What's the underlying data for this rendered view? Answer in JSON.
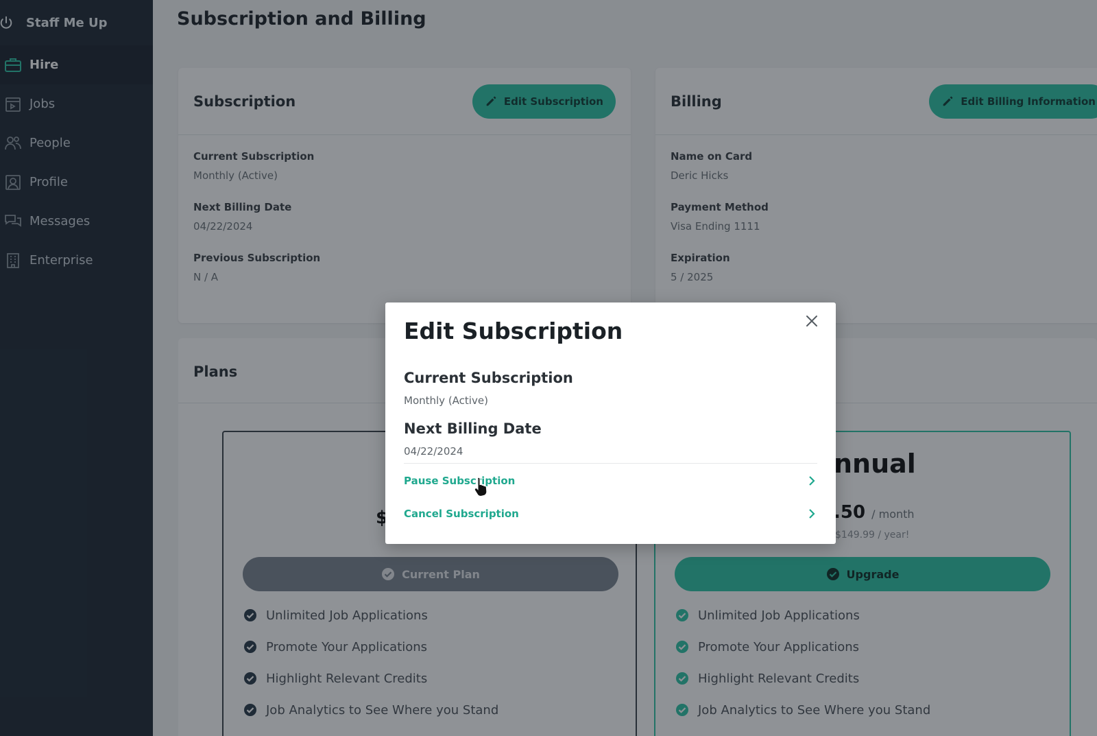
{
  "brand": {
    "name": "Staff Me Up"
  },
  "sidebar": {
    "items": [
      {
        "label": "Hire",
        "icon": "briefcase-icon",
        "active": true
      },
      {
        "label": "Jobs",
        "icon": "jobs-icon"
      },
      {
        "label": "People",
        "icon": "people-icon"
      },
      {
        "label": "Profile",
        "icon": "profile-icon"
      },
      {
        "label": "Messages",
        "icon": "messages-icon"
      },
      {
        "label": "Enterprise",
        "icon": "building-icon"
      }
    ]
  },
  "page": {
    "title": "Subscription and Billing"
  },
  "subscription": {
    "heading": "Subscription",
    "edit_label": "Edit Subscription",
    "current_label": "Current Subscription",
    "current_value": "Monthly (Active)",
    "next_label": "Next Billing Date",
    "next_value": "04/22/2024",
    "previous_label": "Previous Subscription",
    "previous_value": "N / A"
  },
  "billing": {
    "heading": "Billing",
    "edit_label": "Edit Billing Information",
    "name_label": "Name on Card",
    "name_value": "Deric Hicks",
    "method_label": "Payment Method",
    "method_value": "Visa Ending 1111",
    "expiration_label": "Expiration",
    "expiration_value": "5 / 2025"
  },
  "plans": {
    "heading": "Plans",
    "monthly": {
      "price_visible": "$",
      "button": "Current Plan",
      "features": [
        "Unlimited Job Applications",
        "Promote Your Applications",
        "Highlight Relevant Credits",
        "Job Analytics to See Where you Stand"
      ]
    },
    "annual": {
      "title_visible": "nnual",
      "price_visible": ".50",
      "per": "/ month",
      "sub": "$149.99 / year!",
      "button": "Upgrade",
      "features": [
        "Unlimited Job Applications",
        "Promote Your Applications",
        "Highlight Relevant Credits",
        "Job Analytics to See Where you Stand"
      ]
    }
  },
  "modal": {
    "title": "Edit Subscription",
    "current_label": "Current Subscription",
    "current_value": "Monthly (Active)",
    "next_label": "Next Billing Date",
    "next_value": "04/22/2024",
    "pause_label": "Pause Subscription",
    "cancel_label": "Cancel Subscription"
  },
  "colors": {
    "accent": "#2ec4a6",
    "accent_text": "#1fa88e",
    "sidebar": "#1f2a35"
  }
}
